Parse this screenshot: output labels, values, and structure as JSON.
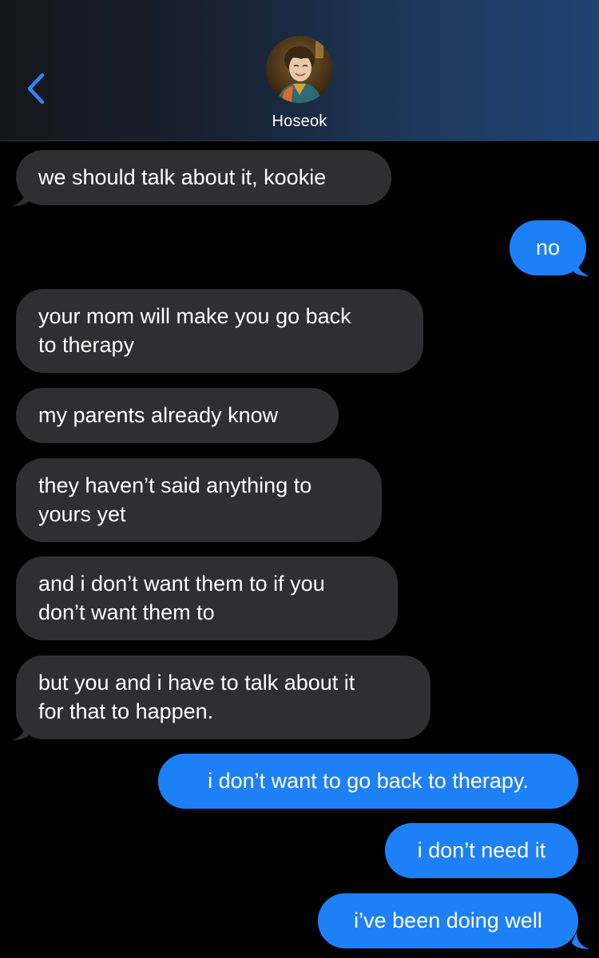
{
  "header": {
    "contact_name": "Hoseok",
    "back_icon": "chevron-left-icon",
    "avatar_icon": "contact-avatar",
    "accent_color": "#1e80f7"
  },
  "conversation": {
    "incoming_color": "#2f2f31",
    "outgoing_color": "#1e80f7",
    "messages": [
      {
        "direction": "in",
        "text": "we should talk about it, kookie"
      },
      {
        "direction": "out",
        "text": "no"
      },
      {
        "direction": "in",
        "lines": [
          "your mom will make you go back",
          "to therapy"
        ]
      },
      {
        "direction": "in",
        "text": "my parents already know"
      },
      {
        "direction": "in",
        "lines": [
          "they haven’t said anything to",
          "yours yet"
        ]
      },
      {
        "direction": "in",
        "lines": [
          "and i don’t want them to if you",
          "don’t want them to"
        ]
      },
      {
        "direction": "in",
        "lines": [
          "but you and i have to talk about it",
          "for that to happen."
        ]
      },
      {
        "direction": "out",
        "text": "i don’t want to go back to therapy."
      },
      {
        "direction": "out",
        "text": "i don’t need it"
      },
      {
        "direction": "out",
        "text": "i’ve been doing well"
      }
    ]
  }
}
